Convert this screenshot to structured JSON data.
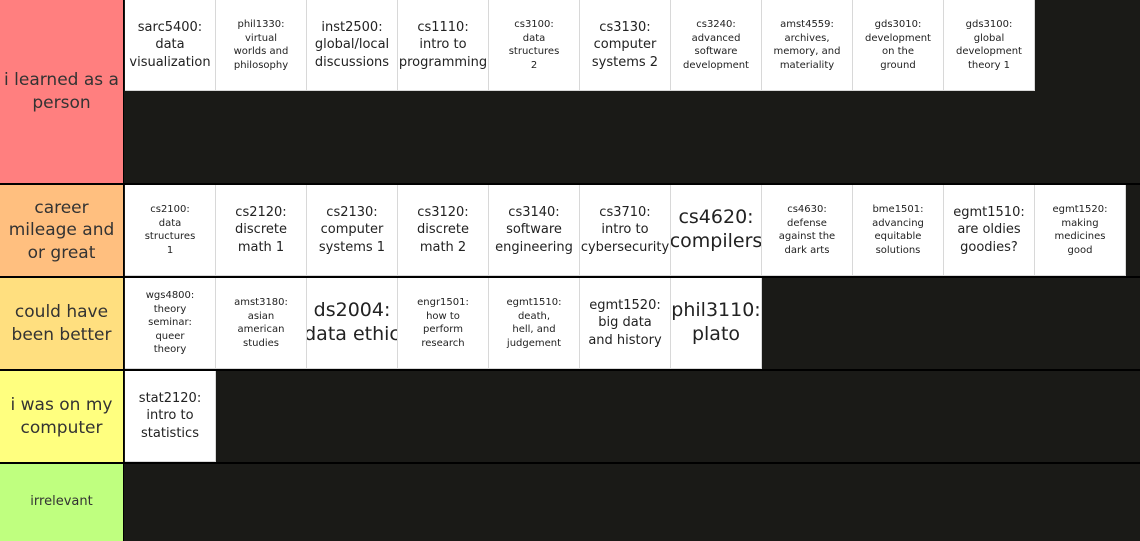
{
  "tiers": [
    {
      "label": "i learned as a\nperson",
      "color": "#ff7f7f",
      "items": [
        {
          "text": "sarc5400:\ndata\nvisualization",
          "size": "m"
        },
        {
          "text": "phil1330:\nvirtual\nworlds and\nphilosophy",
          "size": "s"
        },
        {
          "text": "inst2500:\nglobal/local\ndiscussions",
          "size": "m"
        },
        {
          "text": "cs1110:\nintro to\nprogramming",
          "size": "m"
        },
        {
          "text": "cs3100:\ndata\nstructures\n2",
          "size": "s"
        },
        {
          "text": "cs3130:\ncomputer\nsystems 2",
          "size": "m"
        },
        {
          "text": "cs3240:\nadvanced\nsoftware\ndevelopment",
          "size": "s"
        },
        {
          "text": "amst4559:\narchives,\nmemory, and\nmateriality",
          "size": "s"
        },
        {
          "text": "gds3010:\ndevelopment\non the\nground",
          "size": "s"
        },
        {
          "text": "gds3100:\nglobal\ndevelopment\ntheory 1",
          "size": "s"
        }
      ]
    },
    {
      "label": "career\nmileage and\nor great",
      "color": "#ffbf7f",
      "items": [
        {
          "text": "cs2100:\ndata\nstructures\n1",
          "size": "s"
        },
        {
          "text": "cs2120:\ndiscrete\nmath 1",
          "size": "m"
        },
        {
          "text": "cs2130:\ncomputer\nsystems 1",
          "size": "m"
        },
        {
          "text": "cs3120:\ndiscrete\nmath 2",
          "size": "m"
        },
        {
          "text": "cs3140:\nsoftware\nengineering",
          "size": "m"
        },
        {
          "text": "cs3710:\nintro to\ncybersecurity",
          "size": "m"
        },
        {
          "text": "cs4620:\ncompilers",
          "size": "l"
        },
        {
          "text": "cs4630:\ndefense\nagainst the\ndark arts",
          "size": "s"
        },
        {
          "text": "bme1501:\nadvancing\nequitable\nsolutions",
          "size": "s"
        },
        {
          "text": "egmt1510:\nare oldies\ngoodies?",
          "size": "m"
        },
        {
          "text": "egmt1520:\nmaking\nmedicines\ngood",
          "size": "s"
        }
      ]
    },
    {
      "label": "could have\nbeen better",
      "color": "#ffdf7f",
      "items": [
        {
          "text": "wgs4800:\ntheory\nseminar:\nqueer\ntheory",
          "size": "s"
        },
        {
          "text": "amst3180:\nasian\namerican\nstudies",
          "size": "s"
        },
        {
          "text": "ds2004:\ndata ethic",
          "size": "l"
        },
        {
          "text": "engr1501:\nhow to\nperform\nresearch",
          "size": "s"
        },
        {
          "text": "egmt1510:\ndeath,\nhell, and\njudgement",
          "size": "s"
        },
        {
          "text": "egmt1520:\nbig data\nand history",
          "size": "m"
        },
        {
          "text": "phil3110:\nplato",
          "size": "l"
        }
      ]
    },
    {
      "label": "i was on my\ncomputer",
      "color": "#ffff7f",
      "items": [
        {
          "text": "stat2120:\nintro to\nstatistics",
          "size": "m"
        }
      ]
    },
    {
      "label": "irrelevant",
      "color": "#bfff7f",
      "items": []
    }
  ]
}
